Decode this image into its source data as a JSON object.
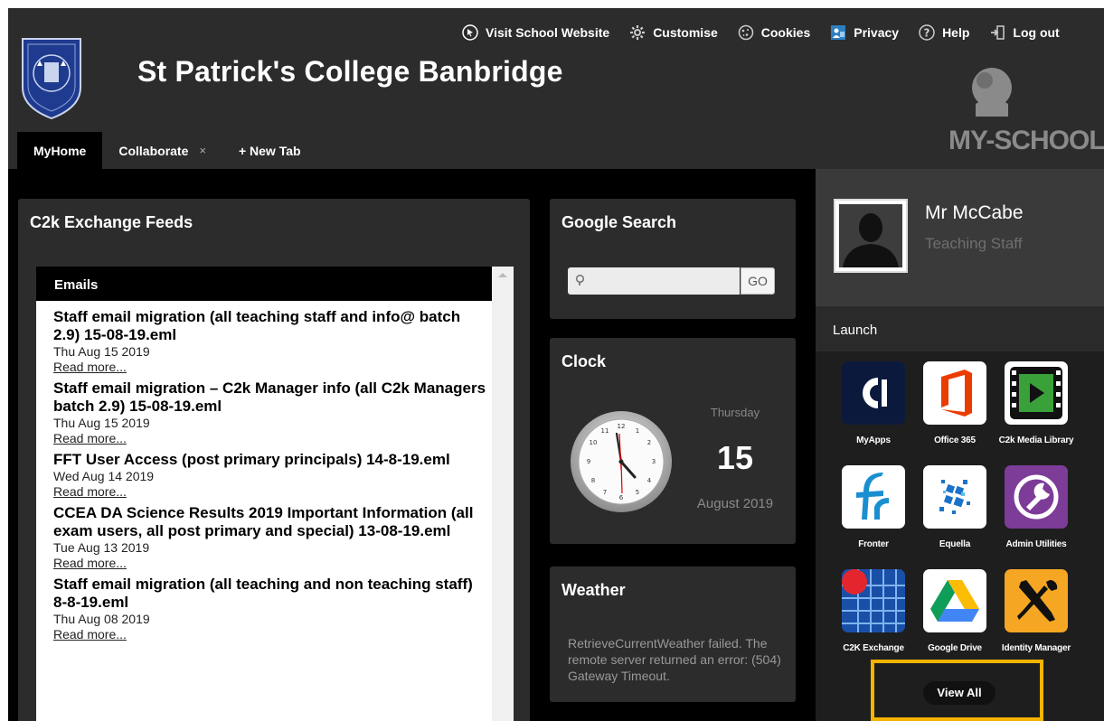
{
  "header": {
    "school_name": "St Patrick's College Banbridge",
    "brand_logo_text": "MY-SCHOOL",
    "links": [
      {
        "label": "Visit School Website",
        "icon": "cursor-icon"
      },
      {
        "label": "Customise",
        "icon": "gear-icon"
      },
      {
        "label": "Cookies",
        "icon": "cookie-icon"
      },
      {
        "label": "Privacy",
        "icon": "privacy-icon"
      },
      {
        "label": "Help",
        "icon": "help-icon"
      },
      {
        "label": "Log out",
        "icon": "logout-icon"
      }
    ]
  },
  "tabs": [
    {
      "label": "MyHome",
      "active": true
    },
    {
      "label": "Collaborate",
      "close": "×"
    },
    {
      "label": "+ New Tab"
    }
  ],
  "feeds": {
    "title": "C2k Exchange Feeds",
    "section": "Emails",
    "emails": [
      {
        "title": "Staff email migration (all teaching staff and info@ batch 2.9) 15-08-19.eml",
        "date": "Thu Aug 15 2019",
        "more": "Read more..."
      },
      {
        "title": "Staff email migration – C2k Manager info (all C2k Managers batch 2.9) 15-08-19.eml",
        "date": "Thu Aug 15 2019",
        "more": "Read more..."
      },
      {
        "title": "FFT User Access (post primary principals) 14-8-19.eml",
        "date": "Wed Aug 14 2019",
        "more": "Read more..."
      },
      {
        "title": "CCEA DA Science Results 2019 Important Information (all exam users, all post primary and special) 13-08-19.eml",
        "date": "Tue Aug 13 2019",
        "more": "Read more..."
      },
      {
        "title": "Staff email migration (all teaching and non teaching staff) 8-8-19.eml",
        "date": "Thu Aug 08 2019",
        "more": "Read more..."
      }
    ]
  },
  "google_search": {
    "title": "Google Search",
    "go_label": "GO"
  },
  "clock": {
    "title": "Clock",
    "day": "Thursday",
    "date": "15",
    "month_year": "August 2019"
  },
  "weather": {
    "title": "Weather",
    "message": "RetrieveCurrentWeather failed. The remote server returned an error: (504) Gateway Timeout."
  },
  "profile": {
    "name": "Mr McCabe",
    "role": "Teaching Staff"
  },
  "launch": {
    "title": "Launch",
    "apps": [
      {
        "label": "MyApps",
        "icon": "myapps-icon"
      },
      {
        "label": "Office 365",
        "icon": "office-365-icon"
      },
      {
        "label": "C2k Media Library",
        "icon": "media-library-icon"
      },
      {
        "label": "Fronter",
        "icon": "fronter-icon"
      },
      {
        "label": "Equella",
        "icon": "equella-icon"
      },
      {
        "label": "Admin Utilities",
        "icon": "admin-utilities-icon"
      },
      {
        "label": "C2K Exchange",
        "icon": "c2k-exchange-icon"
      },
      {
        "label": "Google Drive",
        "icon": "google-drive-icon"
      },
      {
        "label": "Identity Manager",
        "icon": "identity-manager-icon"
      }
    ],
    "view_all": "View All"
  },
  "colors": {
    "header_bg": "#2c2c2c",
    "highlight": "#f4b400",
    "office_orange": "#eb3c00",
    "fronter_blue": "#1a8fd0",
    "admin_purple": "#7d3c98",
    "identity_yellow": "#f5a623"
  }
}
